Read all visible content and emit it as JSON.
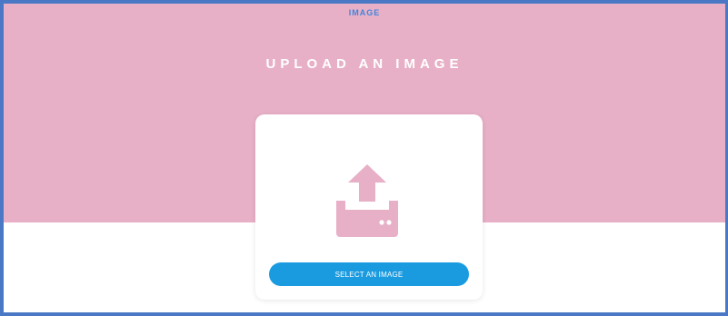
{
  "header": {
    "top_label": "IMAGE",
    "title": "UPLOAD AN IMAGE"
  },
  "upload_card": {
    "icon": "upload-icon",
    "button_label": "SELECT AN IMAGE"
  },
  "colors": {
    "hero_background": "#e8b0c7",
    "frame_border": "#4a78c4",
    "top_label": "#3f86dd",
    "title": "#ffffff",
    "icon": "#e8b0c7",
    "button_background": "#1a9be0",
    "button_text": "#ffffff"
  }
}
